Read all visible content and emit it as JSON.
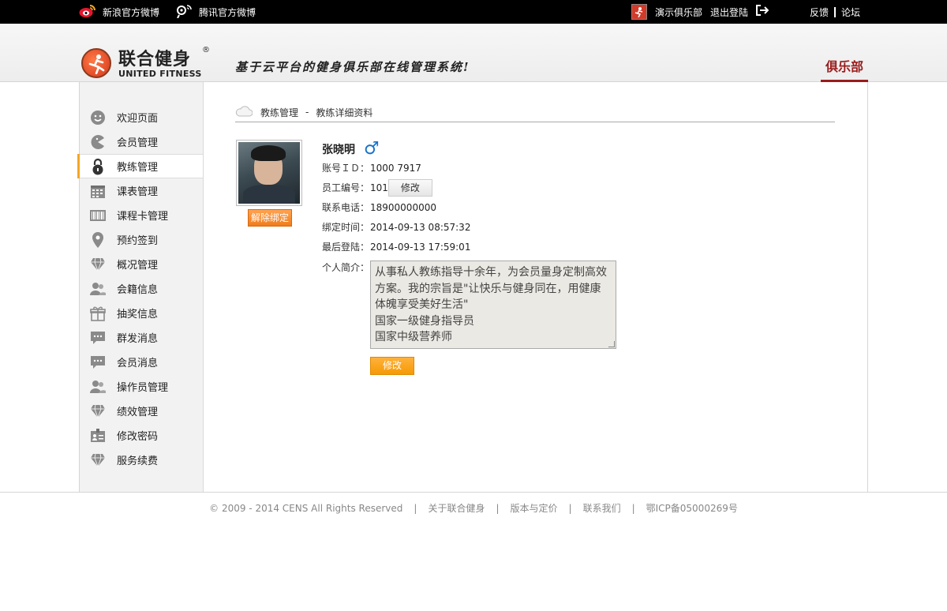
{
  "topbar": {
    "sina_weibo": "新浪官方微博",
    "tencent_weibo": "腾讯官方微博",
    "club_name": "演示俱乐部",
    "logout": "退出登陆",
    "feedback": "反馈",
    "forum": "论坛"
  },
  "header": {
    "logo_cn": "联合健身",
    "logo_reg": "®",
    "logo_en": "UNITED FITNESS",
    "slogan": "基于云平台的健身俱乐部在线管理系统!",
    "club_tab": "俱乐部"
  },
  "sidebar": {
    "items": [
      {
        "label": "欢迎页面",
        "icon": "smile-icon"
      },
      {
        "label": "会员管理",
        "icon": "pacman-icon"
      },
      {
        "label": "教练管理",
        "icon": "lock-icon"
      },
      {
        "label": "课表管理",
        "icon": "calendar-icon"
      },
      {
        "label": "课程卡管理",
        "icon": "barcode-icon"
      },
      {
        "label": "预约签到",
        "icon": "map-pin-icon"
      },
      {
        "label": "概况管理",
        "icon": "diamond-icon"
      },
      {
        "label": "会籍信息",
        "icon": "users-icon"
      },
      {
        "label": "抽奖信息",
        "icon": "gift-icon"
      },
      {
        "label": "群发消息",
        "icon": "chat-icon"
      },
      {
        "label": "会员消息",
        "icon": "chat-icon"
      },
      {
        "label": "操作员管理",
        "icon": "users-icon"
      },
      {
        "label": "绩效管理",
        "icon": "diamond-icon"
      },
      {
        "label": "修改密码",
        "icon": "id-card-icon"
      },
      {
        "label": "服务续费",
        "icon": "diamond-icon"
      }
    ],
    "active_index": 2
  },
  "breadcrumb": {
    "parent": "教练管理",
    "sep": "-",
    "current": "教练详细资料"
  },
  "coach": {
    "unbind_label": "解除绑定",
    "name": "张晓明",
    "gender_symbol": "♂",
    "account_label": "账号ＩＤ：",
    "account_value": "1000 7917",
    "staff_label": "员工编号：",
    "staff_value": "101",
    "staff_edit_label": "修改",
    "phone_label": "联系电话：",
    "phone_value": "18900000000",
    "bind_time_label": "绑定时间：",
    "bind_time_value": "2014-09-13 08:57:32",
    "last_login_label": "最后登陆：",
    "last_login_value": "2014-09-13 17:59:01",
    "bio_label": "个人简介：",
    "bio_text": "从事私人教练指导十余年，为会员量身定制高效方案。我的宗旨是\"让快乐与健身同在，用健康体魄享受美好生活\"\n国家一级健身指导员\n国家中级营养师",
    "save_label": "修改"
  },
  "footer": {
    "copyright": "© 2009 - 2014 CENS All Rights Reserved",
    "sep": "|",
    "about": "关于联合健身",
    "pricing": "版本与定价",
    "contact": "联系我们",
    "icp": "鄂ICP备05000269号"
  },
  "colors": {
    "accent_orange": "#f5a623",
    "brand_red": "#9a1c1c",
    "male_blue": "#1a73c9"
  }
}
